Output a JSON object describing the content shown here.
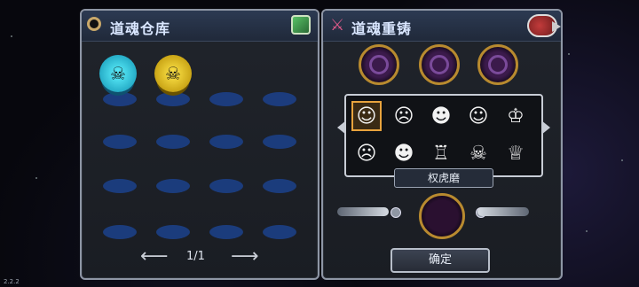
{
  "left_panel": {
    "title": "道魂仓库",
    "pager": {
      "page": "1/1"
    },
    "souls": [
      {
        "type": "cyan-skull"
      },
      {
        "type": "gold-skull"
      }
    ]
  },
  "right_panel": {
    "title": "道魂重铸",
    "hero_name": "权虎磨",
    "confirm_label": "确定"
  },
  "version": "2.2.2"
}
